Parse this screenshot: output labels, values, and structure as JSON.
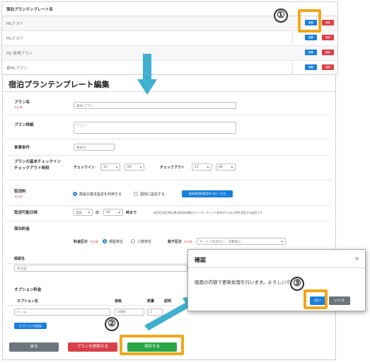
{
  "list": {
    "header": "宿泊プランテンプレート名",
    "rows": [
      {
        "name": "MLテスト"
      },
      {
        "name": "MLテスト"
      },
      {
        "name": "ML 新規プラン"
      },
      {
        "name": "素MLプラン"
      }
    ],
    "edit_label": "編集",
    "delete_label": "削除"
  },
  "annotations": {
    "step1": "①",
    "step2": "②",
    "step3": "③"
  },
  "edit": {
    "title": "宿泊プランテンプレート編集",
    "required": "※必須",
    "plan_name_label": "プラン名",
    "plan_name_value": "素MLプラン",
    "plan_detail_label": "プラン詳細",
    "plan_detail_value": "テスト",
    "meal_label": "食事条件",
    "meal_value": "朝食付",
    "checkinout_label_1": "プランの基本チェックイン",
    "checkinout_label_2": "チェックアウト時刻",
    "checkin_label": "チェックイン",
    "checkin_hour": "15",
    "checkin_min": "00",
    "checkout_label": "チェックアウト",
    "checkout_hour": "11",
    "checkout_min": "00",
    "colon": ":",
    "cancel_label": "取消料",
    "cancel_opt1": "施設の基本設定を利用する",
    "cancel_opt2": "個別に設定する",
    "cancel_copy_button": "基本取消料設定をコピーする",
    "cancel_deadline_label": "取消可能日時",
    "deadline_day": "当日",
    "deadline_no": "の",
    "deadline_time": "00",
    "deadline_suffix": "時まで",
    "deadline_note": "※取消可能日時以降は取消料無料がインターネットで取消ができる日時を指定する項目です",
    "fee_label": "宿泊料金",
    "fee_class_label": "料金区分",
    "fee_class_opt1": "部屋単位",
    "fee_class_opt2": "人数単位",
    "tax_label": "税サ区分",
    "tax_value": "サービス料別なし・消費税込",
    "room_label": "部屋名",
    "room_value": "和洋室",
    "option_fee_label": "オプション料金",
    "option_cols": [
      "オプション名",
      "価格",
      "数量",
      "説明"
    ],
    "option_row": {
      "name": "ケーキ",
      "price": "1000",
      "qty": "1"
    },
    "option_add_button": "オプションの追加",
    "back_button": "戻る",
    "delete_plan_button": "プランを削除する",
    "save_button": "保存する"
  },
  "dialog": {
    "title": "確認",
    "close": "×",
    "message": "画面の内容で更新処理を行います。よろしいですか？",
    "yes": "はい",
    "no": "いいえ"
  },
  "colors": {
    "primary": "#1a7fdc",
    "danger": "#d9414a",
    "success": "#28a745",
    "secondary": "#6c757d",
    "highlight": "#f0a81c",
    "arrow": "#3fb0cf"
  }
}
